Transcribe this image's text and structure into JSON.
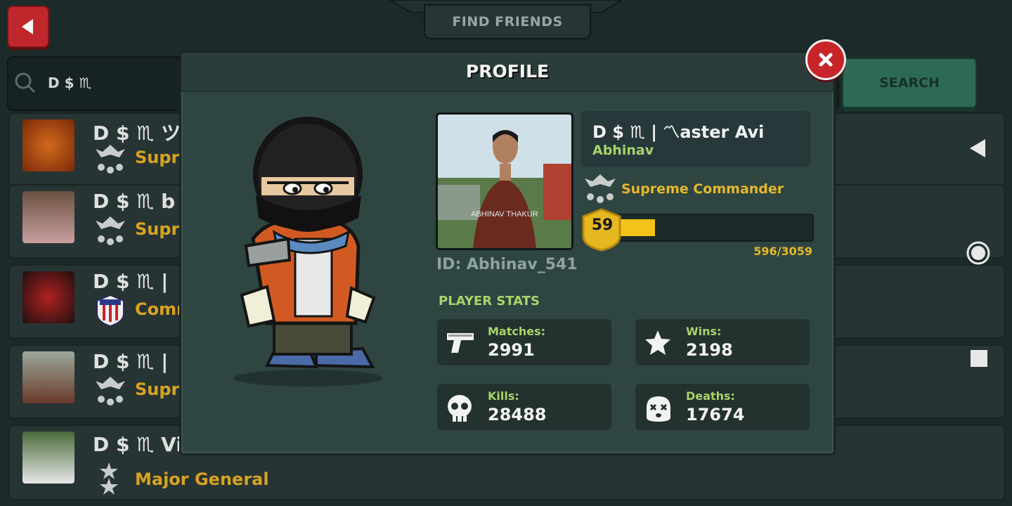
{
  "header": {
    "title": "FIND FRIENDS"
  },
  "search": {
    "value": "D $ ♏",
    "button_label": "SEARCH"
  },
  "list": [
    {
      "name": "D $ ♏ ツ",
      "rank": "Supre"
    },
    {
      "name": "D $ ♏ b",
      "rank": "Supre"
    },
    {
      "name": "D $ ♏ |",
      "rank": "Comm"
    },
    {
      "name": "D $ ♏ |",
      "rank": "Supre"
    },
    {
      "name": "D $ ♏ Vi",
      "rank": "Major General"
    }
  ],
  "profile": {
    "title": "PROFILE",
    "display_name": "D $ ♏ | 〽aster Avi",
    "sub_name": "Abhinav",
    "rank": "Supreme Commander",
    "level": "59",
    "xp_text": "596/3059",
    "xp_fraction": 0.195,
    "player_id": "ID: Abhinav_541",
    "photo_watermark": "ABHINAV THAKUR",
    "stats_heading": "PLAYER STATS",
    "stats": [
      {
        "label": "Matches:",
        "value": "2991",
        "icon": "pistol-icon"
      },
      {
        "label": "Wins:",
        "value": "2198",
        "icon": "star-icon"
      },
      {
        "label": "Kills:",
        "value": "28488",
        "icon": "skull-icon"
      },
      {
        "label": "Deaths:",
        "value": "17674",
        "icon": "dead-face-icon"
      }
    ]
  },
  "colors": {
    "accent_red": "#c8252b",
    "rank_gold": "#e6b82c",
    "label_green": "#a8d46a",
    "panel": "#2f4541"
  }
}
